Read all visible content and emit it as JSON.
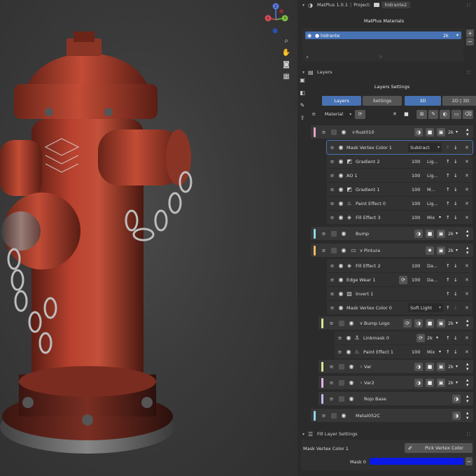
{
  "header": {
    "addon": "MatPlus 1.0.1",
    "project_label": "Project:",
    "project_name": "hidrante2"
  },
  "materials": {
    "title": "MatPlus Materials",
    "items": [
      {
        "name": "hidrante",
        "res": "2k"
      }
    ],
    "add": "+",
    "remove": "−"
  },
  "layers_section": {
    "title": "Layers"
  },
  "layers_settings": {
    "title": "Layers Settings",
    "tabs": [
      {
        "label": "Layers"
      },
      {
        "label": "Settings"
      },
      {
        "label": "3D"
      },
      {
        "label": "2D | 3D"
      }
    ],
    "material_dropdown": "Material"
  },
  "layers": [
    {
      "name": "Rust010",
      "res": "2k",
      "color": "#e8a0c8"
    },
    {
      "name": "Mask Vertex Color 1",
      "blend": "Subtract"
    },
    {
      "name": "Gradient 2",
      "value": "100",
      "blend": "Lig..."
    },
    {
      "name": "AO 1",
      "value": "100",
      "blend": "Lig..."
    },
    {
      "name": "Gradient 1",
      "value": "100",
      "blend": "M..."
    },
    {
      "name": "Paint Effect 0",
      "value": "100",
      "blend": "Lig..."
    },
    {
      "name": "Fill Effect 3",
      "value": "100",
      "blend": "Mix"
    },
    {
      "name": "Bump",
      "res": "2k",
      "color": "#8ed8ea"
    },
    {
      "name": "Pintura",
      "res": "2k",
      "color": "#f0b860"
    },
    {
      "name": "Fill Effect 2",
      "value": "100",
      "blend": "Da..."
    },
    {
      "name": "Edge Wear 1",
      "value": "100",
      "blend": "Da..."
    },
    {
      "name": "Invert 1"
    },
    {
      "name": "Mask Vertex Color 0",
      "blend": "Soft Light"
    },
    {
      "name": "Bump Logo",
      "res": "2k",
      "color": "#d8e890"
    },
    {
      "name": "Linkmask 0",
      "res": "2k"
    },
    {
      "name": "Paint Effect 1",
      "value": "100",
      "blend": "Mix"
    },
    {
      "name": "Var",
      "res": "2k",
      "color": "#d8e890"
    },
    {
      "name": "Var2",
      "res": "2k",
      "color": "#e0b8e8"
    },
    {
      "name": "Rojo Base",
      "color": "#c8b8f0"
    },
    {
      "name": "Metal052C",
      "color": "#8ed8ea"
    }
  ],
  "fill_layer_settings": {
    "title": "Fill Layer Settings",
    "target": "Mask Vertex Color 1",
    "pick_button": "Pick Vertex Color",
    "mask_label": "Mask 0",
    "mask_color": "#0a19e6"
  },
  "gizmo": {
    "z": "Z",
    "x": "X",
    "y": "Y"
  },
  "colors": {
    "accent": "#4772b3",
    "panel": "#2b2b2b",
    "hydrant_red": "#b8412e"
  }
}
